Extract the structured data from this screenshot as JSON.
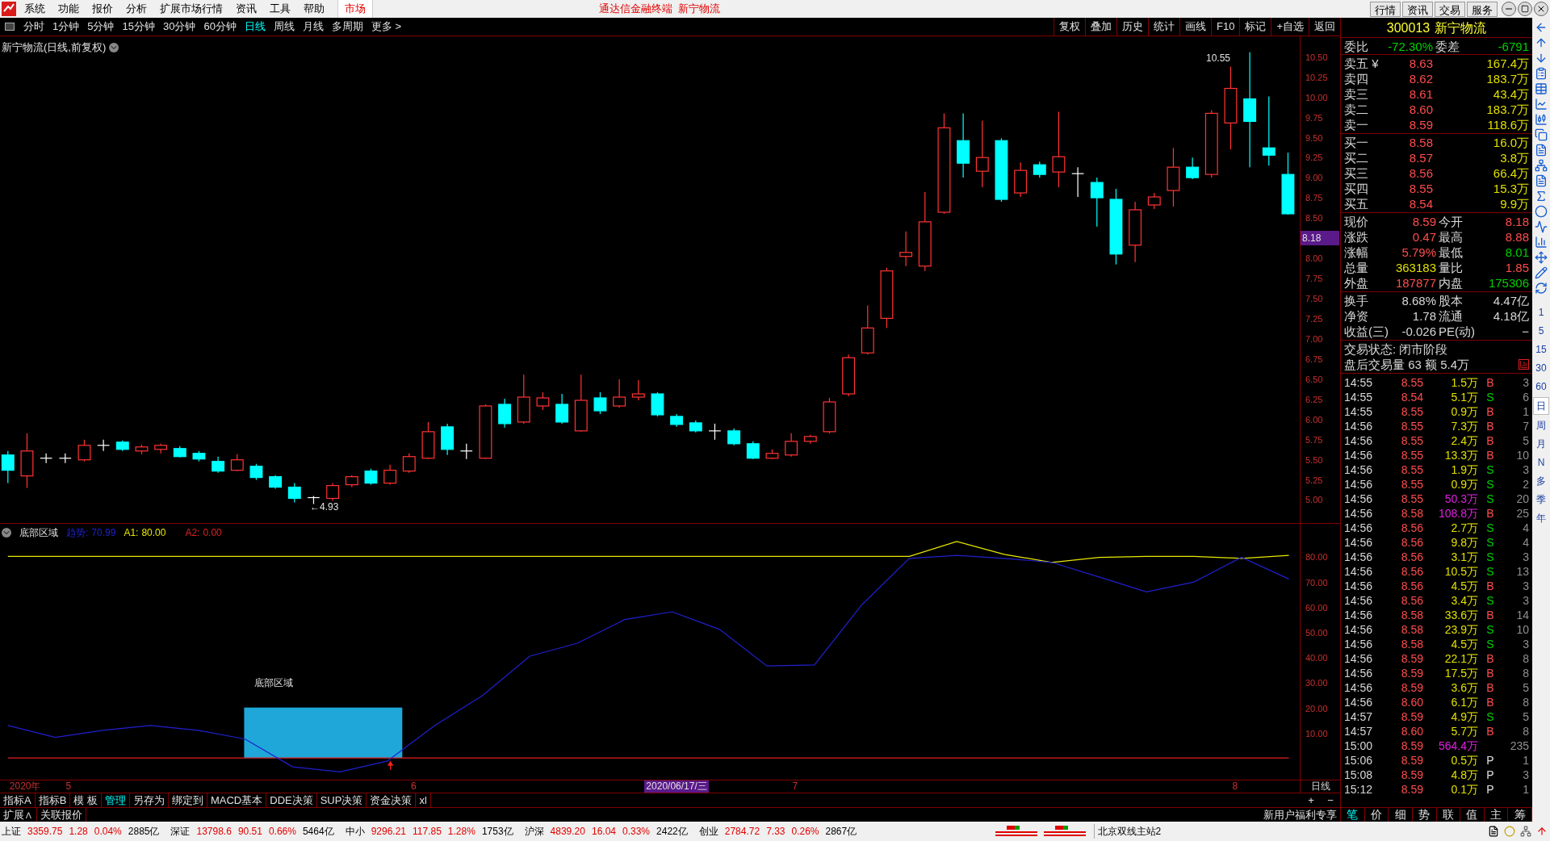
{
  "menu": {
    "items": [
      "系统",
      "功能",
      "报价",
      "分析",
      "扩展市场行情",
      "资讯",
      "工具",
      "帮助"
    ],
    "market_tab": "市场",
    "title": "通达信金融终端  新宁物流",
    "buttons": [
      "行情",
      "资讯",
      "交易",
      "服务"
    ]
  },
  "toolbar": {
    "periods": [
      {
        "label": "分时",
        "selected": false
      },
      {
        "label": "1分钟",
        "selected": false
      },
      {
        "label": "5分钟",
        "selected": false
      },
      {
        "label": "15分钟",
        "selected": false
      },
      {
        "label": "30分钟",
        "selected": false
      },
      {
        "label": "60分钟",
        "selected": false
      },
      {
        "label": "日线",
        "selected": true
      },
      {
        "label": "周线",
        "selected": false
      },
      {
        "label": "月线",
        "selected": false
      },
      {
        "label": "多周期",
        "selected": false
      },
      {
        "label": "更多 >",
        "selected": false
      }
    ],
    "actions": [
      "复权",
      "叠加",
      "历史",
      "统计",
      "画线",
      "F10",
      "标记",
      "+自选",
      "返回"
    ]
  },
  "chart": {
    "title": "新宁物流(日线,前复权)",
    "high_label": "10.55",
    "low_label": "←4.93",
    "current_marker": "8.18",
    "chart_data": {
      "type": "candlestick",
      "ylim": [
        4.694,
        10.748
      ],
      "yticks": [
        {
          "value": 10.5,
          "label": "10.50"
        },
        {
          "value": 10.25,
          "label": "10.25"
        },
        {
          "value": 10,
          "label": "10.00"
        },
        {
          "value": 9.75,
          "label": "9.75"
        },
        {
          "value": 9.5,
          "label": "9.50"
        },
        {
          "value": 9.25,
          "label": "9.25"
        },
        {
          "value": 9,
          "label": "9.00"
        },
        {
          "value": 8.75,
          "label": "8.75"
        },
        {
          "value": 8.5,
          "label": "8.50"
        },
        {
          "value": 8,
          "label": "8.00"
        },
        {
          "value": 7.75,
          "label": "7.75"
        },
        {
          "value": 7.5,
          "label": "7.50"
        },
        {
          "value": 7.25,
          "label": "7.25"
        },
        {
          "value": 7,
          "label": "7.00"
        },
        {
          "value": 6.75,
          "label": "6.75"
        },
        {
          "value": 6.5,
          "label": "6.50"
        },
        {
          "value": 6.25,
          "label": "6.25"
        },
        {
          "value": 6,
          "label": "6.00"
        },
        {
          "value": 5.75,
          "label": "5.75"
        },
        {
          "value": 5.5,
          "label": "5.50"
        },
        {
          "value": 5.25,
          "label": "5.25"
        },
        {
          "value": 5,
          "label": "5.00"
        }
      ],
      "ohlc": [
        [
          5.54,
          5.59,
          5.19,
          5.35
        ],
        [
          5.28,
          5.81,
          5.13,
          5.59
        ],
        [
          5.5,
          5.56,
          5.44,
          5.5
        ],
        [
          5.5,
          5.56,
          5.44,
          5.5
        ],
        [
          5.48,
          5.73,
          5.46,
          5.66
        ],
        [
          5.66,
          5.73,
          5.59,
          5.66
        ],
        [
          5.7,
          5.72,
          5.59,
          5.61
        ],
        [
          5.59,
          5.67,
          5.55,
          5.64
        ],
        [
          5.61,
          5.68,
          5.56,
          5.66
        ],
        [
          5.62,
          5.65,
          5.51,
          5.52
        ],
        [
          5.56,
          5.59,
          5.46,
          5.49
        ],
        [
          5.46,
          5.52,
          5.32,
          5.34
        ],
        [
          5.35,
          5.55,
          5.34,
          5.48
        ],
        [
          5.4,
          5.43,
          5.23,
          5.26
        ],
        [
          5.27,
          5.29,
          5.12,
          5.14
        ],
        [
          5.14,
          5.19,
          4.95,
          5.0
        ],
        [
          5.01,
          5.03,
          4.93,
          5.01
        ],
        [
          5.0,
          5.19,
          4.97,
          5.16
        ],
        [
          5.17,
          5.29,
          5.14,
          5.27
        ],
        [
          5.34,
          5.37,
          5.17,
          5.19
        ],
        [
          5.19,
          5.42,
          5.17,
          5.35
        ],
        [
          5.34,
          5.56,
          5.32,
          5.52
        ],
        [
          5.5,
          5.95,
          5.49,
          5.83
        ],
        [
          5.89,
          5.93,
          5.54,
          5.61
        ],
        [
          5.59,
          5.68,
          5.49,
          5.59
        ],
        [
          5.5,
          6.17,
          5.49,
          6.15
        ],
        [
          6.17,
          6.24,
          5.88,
          5.93
        ],
        [
          5.95,
          6.54,
          5.93,
          6.26
        ],
        [
          6.15,
          6.32,
          6.1,
          6.25
        ],
        [
          6.17,
          6.3,
          5.93,
          5.95
        ],
        [
          5.84,
          6.54,
          5.83,
          6.22
        ],
        [
          6.25,
          6.32,
          6.05,
          6.09
        ],
        [
          6.15,
          6.48,
          6.13,
          6.26
        ],
        [
          6.26,
          6.47,
          6.22,
          6.3
        ],
        [
          6.3,
          6.32,
          6.02,
          6.04
        ],
        [
          6.02,
          6.05,
          5.89,
          5.92
        ],
        [
          5.94,
          5.97,
          5.82,
          5.84
        ],
        [
          5.84,
          5.93,
          5.73,
          5.84
        ],
        [
          5.84,
          5.87,
          5.66,
          5.68
        ],
        [
          5.68,
          5.71,
          5.49,
          5.5
        ],
        [
          5.5,
          5.61,
          5.49,
          5.56
        ],
        [
          5.54,
          5.81,
          5.52,
          5.71
        ],
        [
          5.71,
          5.79,
          5.68,
          5.77
        ],
        [
          5.83,
          6.25,
          5.81,
          6.2
        ],
        [
          6.3,
          6.79,
          6.27,
          6.75
        ],
        [
          6.81,
          7.4,
          6.79,
          7.12
        ],
        [
          7.24,
          7.87,
          7.12,
          7.83
        ],
        [
          8.01,
          8.32,
          7.89,
          8.06
        ],
        [
          7.89,
          8.81,
          7.83,
          8.44
        ],
        [
          8.56,
          9.79,
          8.54,
          9.61
        ],
        [
          9.45,
          9.79,
          8.99,
          9.17
        ],
        [
          9.07,
          9.7,
          8.87,
          9.24
        ],
        [
          9.45,
          9.48,
          8.69,
          8.72
        ],
        [
          8.8,
          9.18,
          8.75,
          9.08
        ],
        [
          9.15,
          9.19,
          8.99,
          9.03
        ],
        [
          9.06,
          9.81,
          8.87,
          9.25
        ],
        [
          9.04,
          9.12,
          8.75,
          9.04
        ],
        [
          8.93,
          8.99,
          8.38,
          8.74
        ],
        [
          8.72,
          8.85,
          7.91,
          8.04
        ],
        [
          8.15,
          8.69,
          7.94,
          8.59
        ],
        [
          8.65,
          8.8,
          8.6,
          8.75
        ],
        [
          8.83,
          9.36,
          8.63,
          9.12
        ],
        [
          9.12,
          9.24,
          8.97,
          8.99
        ],
        [
          9.03,
          9.83,
          8.99,
          9.79
        ],
        [
          9.67,
          10.37,
          9.34,
          10.1
        ],
        [
          9.97,
          10.55,
          9.12,
          9.69
        ],
        [
          9.36,
          10.0,
          9.14,
          9.27
        ],
        [
          9.03,
          9.3,
          8.53,
          8.54
        ]
      ]
    }
  },
  "indicator": {
    "name": "底部区域",
    "readings": [
      "70.99",
      "80.00",
      "0.00"
    ],
    "zone_label": "底部区域",
    "chart_data": {
      "type": "line",
      "ylim": [
        -8.6,
        92.9
      ],
      "yticks": [
        {
          "value": 80,
          "label": "80.00"
        },
        {
          "value": 70,
          "label": "70.00"
        },
        {
          "value": 60,
          "label": "60.00"
        },
        {
          "value": 50,
          "label": "50.00"
        },
        {
          "value": 40,
          "label": "40.00"
        },
        {
          "value": 30,
          "label": "30.00"
        },
        {
          "value": 20,
          "label": "20.00"
        },
        {
          "value": 10,
          "label": "10.00"
        }
      ],
      "series": [
        {
          "name": "趋势:",
          "color": "#2020d0",
          "values": [
            12.9,
            8.2,
            11.0,
            12.9,
            11.0,
            7.5,
            -3.5,
            -5.5,
            -1.2,
            12.9,
            24.7,
            40.4,
            45.5,
            54.9,
            58.0,
            51.0,
            36.5,
            36.9,
            60.8,
            79.2,
            80.4,
            79.2,
            77.6,
            71.8,
            65.9,
            69.8,
            79.6,
            71.0
          ]
        },
        {
          "name": "A1:",
          "color": "#e8e800",
          "values": [
            80,
            80,
            80,
            80,
            80,
            80,
            80,
            80,
            80,
            80,
            80,
            80,
            80,
            80,
            80,
            80,
            80,
            80,
            80,
            80,
            85.9,
            80.8,
            77.6,
            79.6,
            80,
            80,
            79.2,
            80.4
          ]
        },
        {
          "name": "A2:",
          "color": "#e02020",
          "values": [
            0,
            0,
            0,
            0,
            0,
            0,
            0,
            0,
            0,
            0,
            0,
            0,
            0,
            0,
            0,
            0,
            0,
            0,
            0,
            0,
            0,
            0,
            0,
            0,
            0,
            0,
            0,
            0
          ]
        }
      ]
    }
  },
  "date_axis": {
    "labels": [
      "2020年",
      "5",
      "6",
      "2020/06/17/三",
      "7",
      "8"
    ],
    "period": "日线"
  },
  "bottom_tabs": [
    {
      "label": "指标A",
      "selected": false
    },
    {
      "label": "指标B",
      "selected": false
    },
    {
      "label": "模 板",
      "selected": false
    },
    {
      "label": "管理",
      "selected": true
    },
    {
      "label": "另存为",
      "selected": false
    },
    {
      "label": "绑定到",
      "selected": false
    },
    {
      "label": "MACD基本",
      "selected": false
    },
    {
      "label": "DDE决策",
      "selected": false
    },
    {
      "label": "SUP决策",
      "selected": false
    },
    {
      "label": "资金决策",
      "selected": false
    },
    {
      "label": "xl",
      "selected": false
    }
  ],
  "zoom_buttons": [
    "+",
    "−"
  ],
  "extension_row": [
    "扩展∧",
    "关联报价"
  ],
  "promo": "新用户福利专享",
  "quote": {
    "code": "300013",
    "name": "新宁物流",
    "ratio_label": "委比",
    "ratio": "-72.30%",
    "diff_label": "委差",
    "diff": "-6791",
    "asks": [
      {
        "label": "卖五 ¥",
        "price": "8.63",
        "volume": "167.4万"
      },
      {
        "label": "卖四",
        "price": "8.62",
        "volume": "183.7万"
      },
      {
        "label": "卖三",
        "price": "8.61",
        "volume": "43.4万"
      },
      {
        "label": "卖二",
        "price": "8.60",
        "volume": "183.7万"
      },
      {
        "label": "卖一",
        "price": "8.59",
        "volume": "118.6万"
      }
    ],
    "bids": [
      {
        "label": "买一",
        "price": "8.58",
        "volume": "16.0万"
      },
      {
        "label": "买二",
        "price": "8.57",
        "volume": "3.8万"
      },
      {
        "label": "买三",
        "price": "8.56",
        "volume": "66.4万"
      },
      {
        "label": "买四",
        "price": "8.55",
        "volume": "15.3万"
      },
      {
        "label": "买五",
        "price": "8.54",
        "volume": "9.9万"
      }
    ],
    "stats": [
      {
        "label": "现价",
        "value": "8.59",
        "color": "#ff4d4d"
      },
      {
        "label": "今开",
        "value": "8.18",
        "color": "#ff4d4d"
      },
      {
        "label": "涨跌",
        "value": "0.47",
        "color": "#ff4d4d"
      },
      {
        "label": "最高",
        "value": "8.88",
        "color": "#ff4d4d"
      },
      {
        "label": "涨幅",
        "value": "5.79%",
        "color": "#ff4d4d"
      },
      {
        "label": "最低",
        "value": "8.01",
        "color": "#00d000"
      },
      {
        "label": "总量",
        "value": "363183",
        "color": "#e0e000"
      },
      {
        "label": "量比",
        "value": "1.85",
        "color": "#ff4d4d"
      },
      {
        "label": "外盘",
        "value": "187877",
        "color": "#ff4d4d"
      },
      {
        "label": "内盘",
        "value": "175306",
        "color": "#00d000"
      }
    ],
    "fundamentals": [
      {
        "label": "换手",
        "value": "8.68%"
      },
      {
        "label": "股本",
        "value": "4.47亿"
      },
      {
        "label": "净资",
        "value": "1.78"
      },
      {
        "label": "流通",
        "value": "4.18亿"
      },
      {
        "label": "收益(三)",
        "value": "-0.026"
      },
      {
        "label": "PE(动)",
        "value": "−"
      }
    ],
    "status": "交易状态: 闭市阶段",
    "after_hours": "盘后交易量 63 额 5.4万"
  },
  "trades": [
    {
      "time": "14:55",
      "price": "8.55",
      "volume": "1.5万",
      "big": false,
      "side": "B",
      "count": "3"
    },
    {
      "time": "14:55",
      "price": "8.54",
      "volume": "5.1万",
      "big": false,
      "side": "S",
      "count": "6"
    },
    {
      "time": "14:55",
      "price": "8.55",
      "volume": "0.9万",
      "big": false,
      "side": "B",
      "count": "1"
    },
    {
      "time": "14:56",
      "price": "8.55",
      "volume": "7.3万",
      "big": false,
      "side": "B",
      "count": "7"
    },
    {
      "time": "14:56",
      "price": "8.55",
      "volume": "2.4万",
      "big": false,
      "side": "B",
      "count": "5"
    },
    {
      "time": "14:56",
      "price": "8.55",
      "volume": "13.3万",
      "big": false,
      "side": "B",
      "count": "10"
    },
    {
      "time": "14:56",
      "price": "8.55",
      "volume": "1.9万",
      "big": false,
      "side": "S",
      "count": "3"
    },
    {
      "time": "14:56",
      "price": "8.55",
      "volume": "0.9万",
      "big": false,
      "side": "S",
      "count": "2"
    },
    {
      "time": "14:56",
      "price": "8.55",
      "volume": "50.3万",
      "big": true,
      "side": "S",
      "count": "20"
    },
    {
      "time": "14:56",
      "price": "8.58",
      "volume": "108.8万",
      "big": true,
      "side": "B",
      "count": "25"
    },
    {
      "time": "14:56",
      "price": "8.56",
      "volume": "2.7万",
      "big": false,
      "side": "S",
      "count": "4"
    },
    {
      "time": "14:56",
      "price": "8.56",
      "volume": "9.8万",
      "big": false,
      "side": "S",
      "count": "4"
    },
    {
      "time": "14:56",
      "price": "8.56",
      "volume": "3.1万",
      "big": false,
      "side": "S",
      "count": "3"
    },
    {
      "time": "14:56",
      "price": "8.56",
      "volume": "10.5万",
      "big": false,
      "side": "S",
      "count": "13"
    },
    {
      "time": "14:56",
      "price": "8.56",
      "volume": "4.5万",
      "big": false,
      "side": "B",
      "count": "3"
    },
    {
      "time": "14:56",
      "price": "8.56",
      "volume": "3.4万",
      "big": false,
      "side": "S",
      "count": "3"
    },
    {
      "time": "14:56",
      "price": "8.58",
      "volume": "33.6万",
      "big": false,
      "side": "B",
      "count": "14"
    },
    {
      "time": "14:56",
      "price": "8.58",
      "volume": "23.9万",
      "big": false,
      "side": "S",
      "count": "10"
    },
    {
      "time": "14:56",
      "price": "8.58",
      "volume": "4.5万",
      "big": false,
      "side": "S",
      "count": "3"
    },
    {
      "time": "14:56",
      "price": "8.59",
      "volume": "22.1万",
      "big": false,
      "side": "B",
      "count": "8"
    },
    {
      "time": "14:56",
      "price": "8.59",
      "volume": "17.5万",
      "big": false,
      "side": "B",
      "count": "8"
    },
    {
      "time": "14:56",
      "price": "8.59",
      "volume": "3.6万",
      "big": false,
      "side": "B",
      "count": "5"
    },
    {
      "time": "14:56",
      "price": "8.60",
      "volume": "6.1万",
      "big": false,
      "side": "B",
      "count": "8"
    },
    {
      "time": "14:57",
      "price": "8.59",
      "volume": "4.9万",
      "big": false,
      "side": "S",
      "count": "5"
    },
    {
      "time": "14:57",
      "price": "8.60",
      "volume": "5.7万",
      "big": false,
      "side": "B",
      "count": "8"
    },
    {
      "time": "15:00",
      "price": "8.59",
      "volume": "564.4万",
      "big": true,
      "count": "235"
    },
    {
      "time": "15:06",
      "price": "8.59",
      "volume": "0.5万",
      "big": false,
      "side": "P",
      "count": "1"
    },
    {
      "time": "15:08",
      "price": "8.59",
      "volume": "4.8万",
      "big": false,
      "side": "P",
      "count": "3"
    },
    {
      "time": "15:12",
      "price": "8.59",
      "volume": "0.1万",
      "big": false,
      "side": "P",
      "count": "1"
    }
  ],
  "trade_tabs": [
    {
      "label": "笔",
      "selected": true
    },
    {
      "label": "价",
      "selected": false
    },
    {
      "label": "细",
      "selected": false
    },
    {
      "label": "势",
      "selected": false
    },
    {
      "label": "联",
      "selected": false
    },
    {
      "label": "值",
      "selected": false
    },
    {
      "label": "主",
      "selected": false
    },
    {
      "label": "筹",
      "selected": false
    }
  ],
  "side_strip": [
    {
      "label": "1",
      "selected": false
    },
    {
      "label": "5",
      "selected": false
    },
    {
      "label": "15",
      "selected": false
    },
    {
      "label": "30",
      "selected": false
    },
    {
      "label": "60",
      "selected": false
    },
    {
      "label": "日",
      "selected": true
    },
    {
      "label": "周",
      "selected": false
    },
    {
      "label": "月",
      "selected": false
    },
    {
      "label": "N",
      "selected": false
    },
    {
      "label": "多",
      "selected": false
    },
    {
      "label": "季",
      "selected": false
    },
    {
      "label": "年",
      "selected": false
    }
  ],
  "status_bar": {
    "indices": [
      {
        "name": "上证",
        "value": "3359.75",
        "change": "1.28",
        "pct": "0.04%",
        "amount": "2885亿"
      },
      {
        "name": "深证",
        "value": "13798.6",
        "change": "90.51",
        "pct": "0.66%",
        "amount": "5464亿"
      },
      {
        "name": "中小",
        "value": "9296.21",
        "change": "117.85",
        "pct": "1.28%",
        "amount": "1753亿"
      },
      {
        "name": "沪深",
        "value": "4839.20",
        "change": "16.04",
        "pct": "0.33%",
        "amount": "2422亿"
      },
      {
        "name": "创业",
        "value": "2784.72",
        "change": "7.33",
        "pct": "0.26%",
        "amount": "2867亿"
      }
    ],
    "server": "北京双线主站2"
  }
}
